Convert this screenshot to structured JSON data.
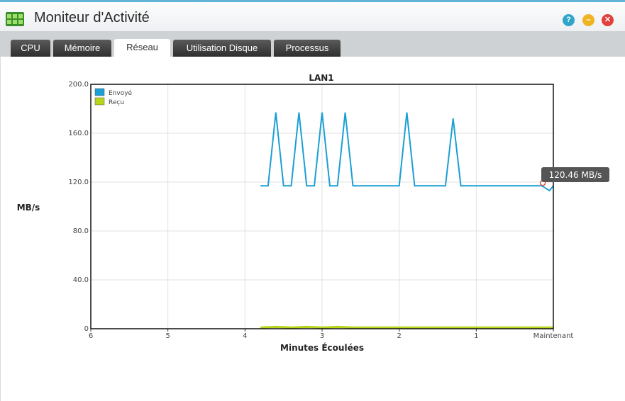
{
  "window": {
    "title": "Moniteur d'Activité",
    "help_glyph": "?",
    "min_glyph": "–",
    "close_glyph": "✕"
  },
  "tabs": [
    {
      "label": "CPU",
      "active": false
    },
    {
      "label": "Mémoire",
      "active": false
    },
    {
      "label": "Réseau",
      "active": true
    },
    {
      "label": "Utilisation Disque",
      "active": false
    },
    {
      "label": "Processus",
      "active": false
    }
  ],
  "colors": {
    "sent": "#1a9fd6",
    "received": "#b5d619",
    "tooltip_bg": "#555555"
  },
  "chart": {
    "title": "LAN1",
    "ylabel": "MB/s",
    "xlabel": "Minutes Écoulées",
    "y_ticks": [
      "200.0",
      "160.0",
      "120.0",
      "80.0",
      "40.0",
      "0"
    ],
    "x_ticks": [
      "6",
      "5",
      "4",
      "3",
      "2",
      "1",
      "Maintenant"
    ],
    "legend": [
      "Envoyé",
      "Reçu"
    ],
    "tooltip": "120.46 MB/s"
  },
  "chart_data": {
    "type": "line",
    "title": "LAN1",
    "xlabel": "Minutes Écoulées",
    "ylabel": "MB/s",
    "xlim": [
      6,
      0
    ],
    "ylim": [
      0,
      200
    ],
    "grid": true,
    "legend_position": "top-left",
    "series": [
      {
        "name": "Envoyé",
        "x": [
          3.8,
          3.7,
          3.6,
          3.5,
          3.4,
          3.3,
          3.2,
          3.1,
          3.0,
          2.9,
          2.8,
          2.7,
          2.6,
          2.5,
          2.0,
          1.9,
          1.8,
          1.4,
          1.3,
          1.2,
          0.8,
          0.15,
          0.05,
          0.0
        ],
        "y": [
          117,
          117,
          177,
          117,
          117,
          177,
          117,
          117,
          177,
          117,
          117,
          177,
          117,
          117,
          117,
          177,
          117,
          117,
          172,
          117,
          117,
          117,
          113,
          117
        ]
      },
      {
        "name": "Reçu",
        "x": [
          3.8,
          3.6,
          3.4,
          3.2,
          3.0,
          2.8,
          2.6,
          2.4,
          2.0,
          1.5,
          1.0,
          0.5,
          0.0
        ],
        "y": [
          1,
          1.5,
          1,
          1.5,
          1,
          1.5,
          1,
          1,
          1,
          1,
          1,
          1,
          1
        ]
      }
    ],
    "highlight": {
      "series": "Envoyé",
      "x": 0.1,
      "y": 120.46,
      "label": "120.46 MB/s"
    }
  }
}
